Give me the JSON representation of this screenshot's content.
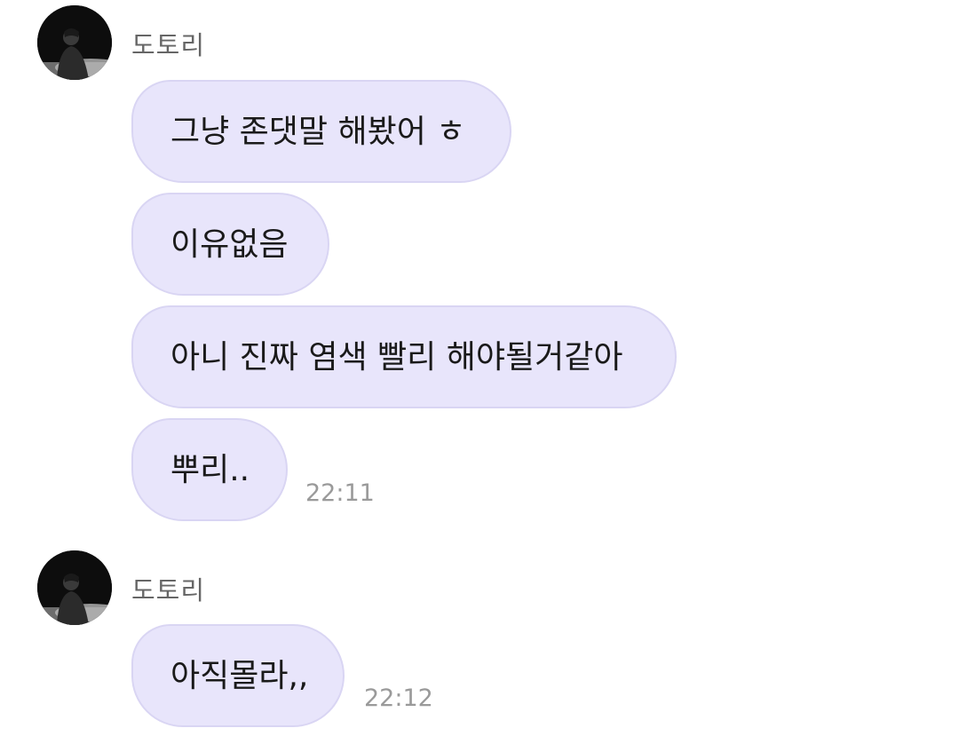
{
  "chat": {
    "groups": [
      {
        "sender": "도토리",
        "avatar_icon": "profile-photo",
        "messages": [
          "그냥 존댓말 해봤어 ㅎ",
          "이유없음",
          "아니 진짜 염색 빨리 해야될거같아",
          "뿌리.."
        ],
        "time": "22:11"
      },
      {
        "sender": "도토리",
        "avatar_icon": "profile-photo",
        "messages": [
          "아직몰라,,"
        ],
        "time": "22:12"
      }
    ]
  },
  "colors": {
    "bubble_bg": "#e8e5fb",
    "bubble_border": "#d9d5f3",
    "name_text": "#666666",
    "time_text": "#9a9a9a"
  }
}
